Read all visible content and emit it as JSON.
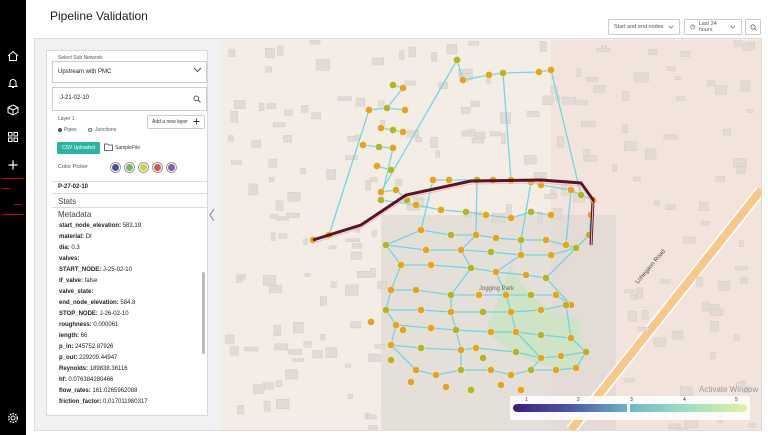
{
  "header": {
    "title": "Pipeline Validation"
  },
  "toolbar": {
    "node_select": "Start and end nodes",
    "time_range": "Last 24 hours"
  },
  "sidebar": {
    "sub_network_label": "Select Sub Network:",
    "sub_network_value": "Upstream with PMC",
    "search_value": "J-21-02-10",
    "layer_label": "Layer 1",
    "radio_pipes": "Pipes",
    "radio_junctions": "Junctions",
    "add_layer_label": "Add a new layer",
    "csv_label": "CSV Uploaded",
    "file_name": "SampleFile",
    "color_picker_label": "Color Picker",
    "swatches": [
      "#4c4d96",
      "#7db36b",
      "#c9d23a",
      "#cf5a4f",
      "#7c62b0"
    ],
    "pipe_id": "P-27-02-10",
    "stats_label": "Stats",
    "metadata_label": "Metadata"
  },
  "properties": [
    {
      "key": "start_node_elevation:",
      "value": "583.19"
    },
    {
      "key": "material:",
      "value": "DI"
    },
    {
      "key": "dia:",
      "value": "0.3"
    },
    {
      "key": "valves:",
      "value": ""
    },
    {
      "key": "START_NODE:",
      "value": "J-25-02-10"
    },
    {
      "key": "if_valve:",
      "value": "false"
    },
    {
      "key": "valve_state:",
      "value": ""
    },
    {
      "key": "end_node_elevation:",
      "value": "584.8"
    },
    {
      "key": "STOP_NODE:",
      "value": "J-26-02-10"
    },
    {
      "key": "roughness:",
      "value": "0.000061"
    },
    {
      "key": "length:",
      "value": "66"
    },
    {
      "key": "p_in:",
      "value": "245752.87926"
    },
    {
      "key": "p_out:",
      "value": "229209.44947"
    },
    {
      "key": "Reynolds:",
      "value": "189838.36116"
    },
    {
      "key": "hf:",
      "value": "0.076384280466"
    },
    {
      "key": "flow_rates:",
      "value": "161.0265962088"
    },
    {
      "key": "friction_factor:",
      "value": "0.017011980317"
    }
  ],
  "map": {
    "road_label": "Lohegaon Road",
    "park_label": "Jogging Park",
    "watermark": "Activate Window",
    "legend_ticks": [
      "1",
      "2",
      "3",
      "4",
      "5"
    ]
  },
  "colors": {
    "pipe": "#5fd6e6",
    "node_orange": "#e8a317",
    "node_olive": "#b7b51d",
    "main_pipe": "#5a1320"
  }
}
